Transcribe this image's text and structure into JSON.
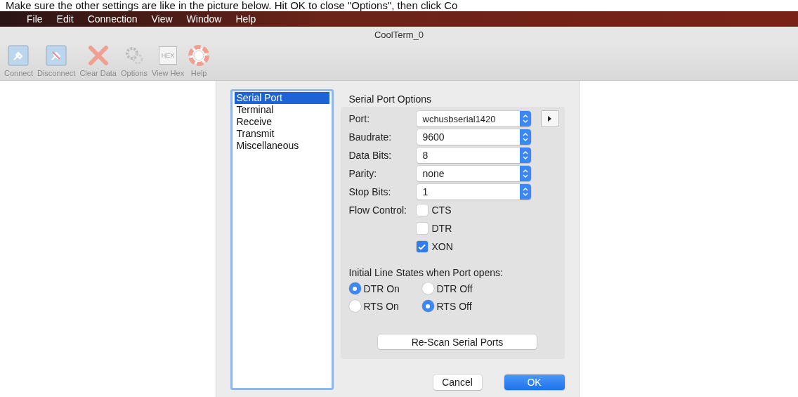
{
  "caption": "Make sure the other settings are like in the picture below. Hit OK to close \"Options\", then click Co",
  "menu": [
    "File",
    "Edit",
    "Connection",
    "View",
    "Window",
    "Help"
  ],
  "window": {
    "title": "CoolTerm_0"
  },
  "toolbar": [
    {
      "kind": "connect",
      "label": "Connect"
    },
    {
      "kind": "disconnect",
      "label": "Disconnect"
    },
    {
      "kind": "clear",
      "label": "Clear Data"
    },
    {
      "kind": "options",
      "label": "Options"
    },
    {
      "kind": "hex",
      "label": "View Hex",
      "icon_text": "HEX"
    },
    {
      "kind": "help",
      "label": "Help"
    }
  ],
  "sidebar": {
    "items": [
      {
        "label": "Serial Port",
        "selected": true
      },
      {
        "label": "Terminal",
        "selected": false
      },
      {
        "label": "Receive",
        "selected": false
      },
      {
        "label": "Transmit",
        "selected": false
      },
      {
        "label": "Miscellaneous",
        "selected": false
      }
    ]
  },
  "section_title": "Serial Port Options",
  "fields": [
    {
      "label": "Port:",
      "value": "wchusbserial1420"
    },
    {
      "label": "Baudrate:",
      "value": "9600"
    },
    {
      "label": "Data Bits:",
      "value": "8"
    },
    {
      "label": "Parity:",
      "value": "none"
    },
    {
      "label": "Stop Bits:",
      "value": "1"
    }
  ],
  "flow_control": {
    "label": "Flow Control:",
    "options": [
      {
        "label": "CTS",
        "checked": false
      },
      {
        "label": "DTR",
        "checked": false
      },
      {
        "label": "XON",
        "checked": true
      }
    ]
  },
  "line_states": {
    "title": "Initial Line States when Port opens:",
    "options": [
      {
        "label": "DTR On",
        "selected": true
      },
      {
        "label": "DTR Off",
        "selected": false
      },
      {
        "label": "RTS On",
        "selected": false
      },
      {
        "label": "RTS Off",
        "selected": true
      }
    ]
  },
  "rescan_button": "Re-Scan Serial Ports",
  "buttons": [
    {
      "label": "Cancel",
      "kind": "secondary"
    },
    {
      "label": "OK",
      "kind": "primary"
    }
  ]
}
